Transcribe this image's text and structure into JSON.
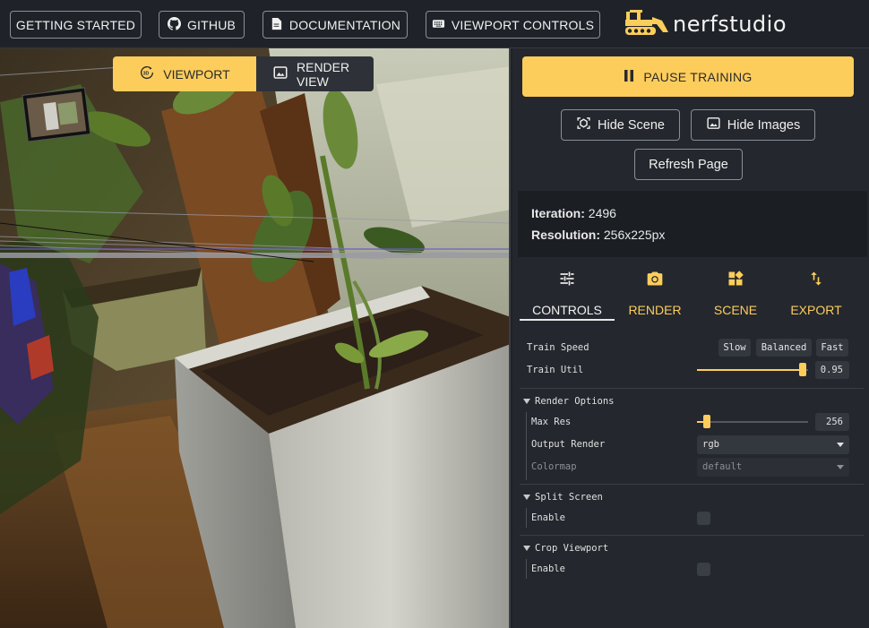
{
  "topbar": {
    "getting_started": "GETTING STARTED",
    "github": "GITHUB",
    "documentation": "DOCUMENTATION",
    "viewport_controls": "VIEWPORT CONTROLS",
    "logo_text": "nerfstudio"
  },
  "viewport": {
    "tabs": [
      {
        "label": "VIEWPORT",
        "icon": "3d-rotation-icon",
        "active": true
      },
      {
        "label": "RENDER VIEW",
        "icon": "image-icon",
        "active": false
      }
    ]
  },
  "panel": {
    "pause_label": "PAUSE TRAINING",
    "hide_scene": "Hide Scene",
    "hide_images": "Hide Images",
    "refresh_page": "Refresh Page",
    "stats": {
      "iteration_label": "Iteration:",
      "iteration_value": "2496",
      "resolution_label": "Resolution:",
      "resolution_value": "256x225px"
    },
    "tabs": [
      {
        "label": "CONTROLS",
        "icon": "tune-icon",
        "active": true
      },
      {
        "label": "RENDER",
        "icon": "camera-icon",
        "active": false
      },
      {
        "label": "SCENE",
        "icon": "widgets-icon",
        "active": false
      },
      {
        "label": "EXPORT",
        "icon": "import-export-icon",
        "active": false
      }
    ]
  },
  "controls": {
    "train_speed": {
      "label": "Train Speed",
      "options": [
        "Slow",
        "Balanced",
        "Fast"
      ]
    },
    "train_util": {
      "label": "Train Util",
      "value": "0.95",
      "fraction": 0.95
    },
    "render_options": {
      "header": "Render Options",
      "max_res": {
        "label": "Max Res",
        "value": "256",
        "fraction": 0.09
      },
      "output_render": {
        "label": "Output Render",
        "value": "rgb"
      },
      "colormap": {
        "label": "Colormap",
        "value": "default"
      }
    },
    "split_screen": {
      "header": "Split Screen",
      "enable_label": "Enable",
      "checked": false
    },
    "crop_viewport": {
      "header": "Crop Viewport",
      "enable_label": "Enable",
      "checked": false
    }
  },
  "colors": {
    "accent": "#fdcd5c",
    "panel": "#24272d",
    "topbar": "#1f2329"
  }
}
